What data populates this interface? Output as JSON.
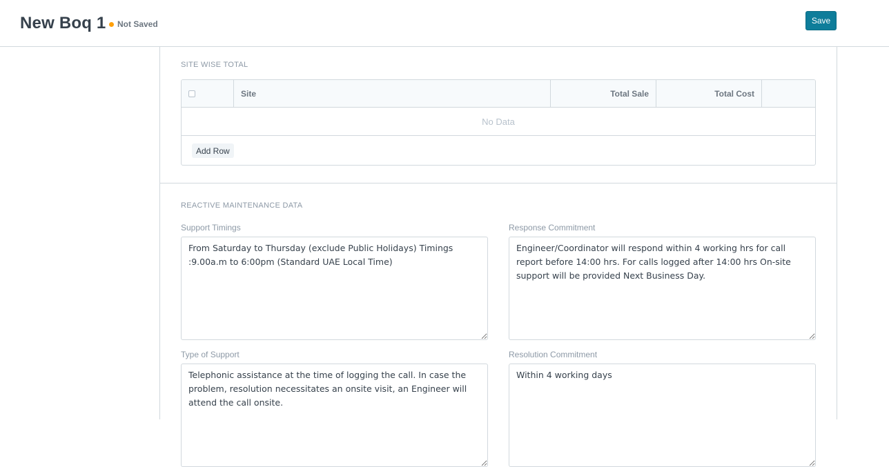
{
  "header": {
    "title": "New Boq 1",
    "status": "Not Saved",
    "save_label": "Save"
  },
  "site_wise_total": {
    "heading": "SITE WISE TOTAL",
    "columns": [
      "Site",
      "Total Sale",
      "Total Cost"
    ],
    "empty_text": "No Data",
    "add_row_label": "Add Row"
  },
  "reactive_maintenance": {
    "heading": "REACTIVE MAINTENANCE DATA",
    "support_timings": {
      "label": "Support Timings",
      "value": "From Saturday to Thursday (exclude Public Holidays) Timings :9.00a.m to 6:00pm (Standard UAE Local Time)"
    },
    "response_commitment": {
      "label": "Response Commitment",
      "value": "Engineer/Coordinator will respond within 4 working hrs for call report before 14:00 hrs. For calls logged after 14:00 hrs On-site support will be provided Next Business Day."
    },
    "type_of_support": {
      "label": "Type of Support",
      "value": "Telephonic assistance at the time of logging the call. In case the problem, resolution necessitates an onsite visit, an Engineer will attend the call onsite."
    },
    "resolution_commitment": {
      "label": "Resolution Commitment",
      "value": "Within 4 working days"
    }
  }
}
